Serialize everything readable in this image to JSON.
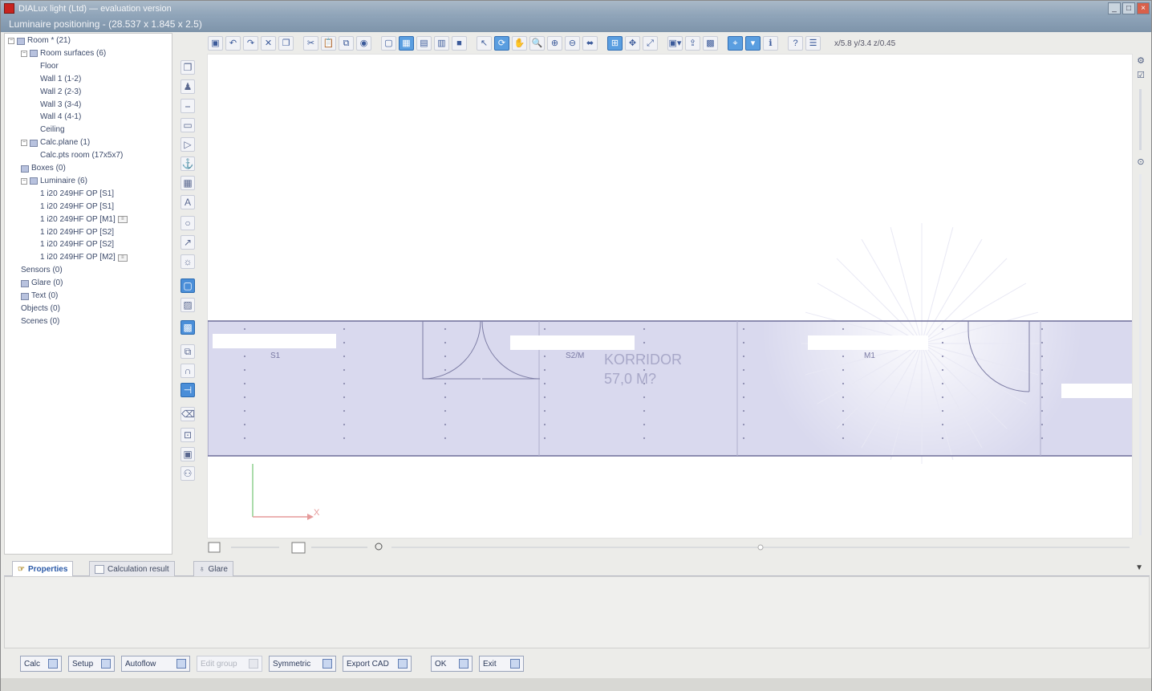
{
  "window": {
    "title": "DIALux light (Ltd) — evaluation version",
    "subtitle": "Luminaire positioning - (28.537 x 1.845 x 2.5)",
    "controls": [
      "_",
      "□",
      "×"
    ]
  },
  "tree": [
    {
      "text": "Room * (21)",
      "level": 0,
      "expander": "−",
      "icon": "room"
    },
    {
      "text": "Room surfaces (6)",
      "level": 1,
      "expander": "−",
      "icon": "surfaces"
    },
    {
      "text": "Floor",
      "level": 2
    },
    {
      "text": "Wall 1 (1-2)",
      "level": 2
    },
    {
      "text": "Wall 2 (2-3)",
      "level": 2
    },
    {
      "text": "Wall 3 (3-4)",
      "level": 2
    },
    {
      "text": "Wall 4 (4-1)",
      "level": 2
    },
    {
      "text": "Ceiling",
      "level": 2
    },
    {
      "text": "Calc.plane (1)",
      "level": 1,
      "expander": "−",
      "icon": "grid"
    },
    {
      "text": "Calc.pts room (17x5x7)",
      "level": 2
    },
    {
      "text": "Boxes (0)",
      "level": 1,
      "icon": "box"
    },
    {
      "text": "Luminaire (6)",
      "level": 1,
      "expander": "−",
      "icon": "lum"
    },
    {
      "text": "1 i20 249HF OP [S1]",
      "level": 2
    },
    {
      "text": "1 i20 249HF OP [S1]",
      "level": 2
    },
    {
      "text": "1 i20 249HF OP [M1]",
      "level": 2,
      "doc": true
    },
    {
      "text": "1 i20 249HF OP [S2]",
      "level": 2
    },
    {
      "text": "1 i20 249HF OP [S2]",
      "level": 2
    },
    {
      "text": "1 i20 249HF OP [M2]",
      "level": 2,
      "doc": true
    },
    {
      "text": "Sensors (0)",
      "level": 1
    },
    {
      "text": "Glare (0)",
      "level": 1,
      "icon": "glare"
    },
    {
      "text": "Text (0)",
      "level": 1,
      "icon": "text"
    },
    {
      "text": "Objects (0)",
      "level": 1
    },
    {
      "text": "Scenes (0)",
      "level": 1
    }
  ],
  "toolbar": {
    "coords": "x/5.8 y/3.4 z/0.45"
  },
  "plan": {
    "room_label": "KORRIDOR",
    "area_label": "57,0 M?",
    "luminaire_tags": [
      "S1",
      "S2/M",
      "M1"
    ],
    "axis_x": "X",
    "fill": "#d9d9ee",
    "stroke": "#8c8cb0"
  },
  "tabs": [
    {
      "label": "Properties",
      "active": true
    },
    {
      "label": "Calculation result",
      "active": false
    },
    {
      "label": "Glare",
      "active": false
    }
  ],
  "buttons": [
    {
      "label": "Calc",
      "disabled": false
    },
    {
      "label": "Setup",
      "disabled": false
    },
    {
      "label": "Autoflow",
      "disabled": false
    },
    {
      "label": "Edit group",
      "disabled": true
    },
    {
      "label": "Symmetric",
      "disabled": false
    },
    {
      "label": "Export CAD",
      "disabled": false
    },
    {
      "label": "OK",
      "disabled": false
    },
    {
      "label": "Exit",
      "disabled": false
    }
  ]
}
